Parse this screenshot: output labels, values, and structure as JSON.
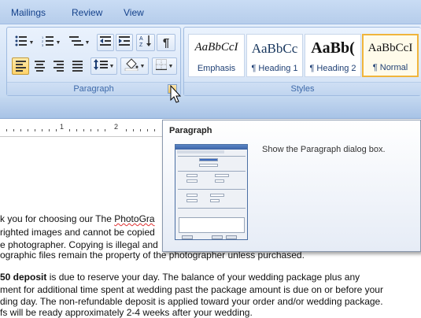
{
  "tabs": [
    "Mailings",
    "Review",
    "View"
  ],
  "paragraph_group": {
    "label": "Paragraph",
    "launcher_icon": "dialog-launcher-icon"
  },
  "styles_group": {
    "label": "Styles",
    "items": [
      {
        "sample": "AaBbCcI",
        "name": "Emphasis"
      },
      {
        "sample": "AaBbCc",
        "name": "¶ Heading 1"
      },
      {
        "sample": "AaBb(",
        "name": "¶ Heading 2"
      },
      {
        "sample": "AaBbCcI",
        "name": "¶ Normal",
        "selected": true
      }
    ]
  },
  "ruler": {
    "numbers": [
      "1",
      "2"
    ]
  },
  "tooltip": {
    "title": "Paragraph",
    "description": "Show the Paragraph dialog box."
  },
  "document": {
    "lines": [
      {
        "pre": "k you for choosing our The ",
        "squiggle": "PhotoGra",
        "post": ""
      },
      {
        "text": "righted images and cannot be copied"
      },
      {
        "text": "e photographer. Copying is illegal and"
      },
      {
        "text": "ographic files remain the property of the photographer unless purchased."
      },
      {
        "bold": "50 deposit",
        "post": " is due to reserve your day. The balance of your wedding package plus any"
      },
      {
        "text": "ment for additional time spent at wedding past the  package amount is due on or before your"
      },
      {
        "text": "ding day. The non-refundable deposit is applied toward your order and/or wedding package."
      },
      {
        "text": "fs will be ready approximately 2-4 weeks after your wedding."
      }
    ]
  }
}
